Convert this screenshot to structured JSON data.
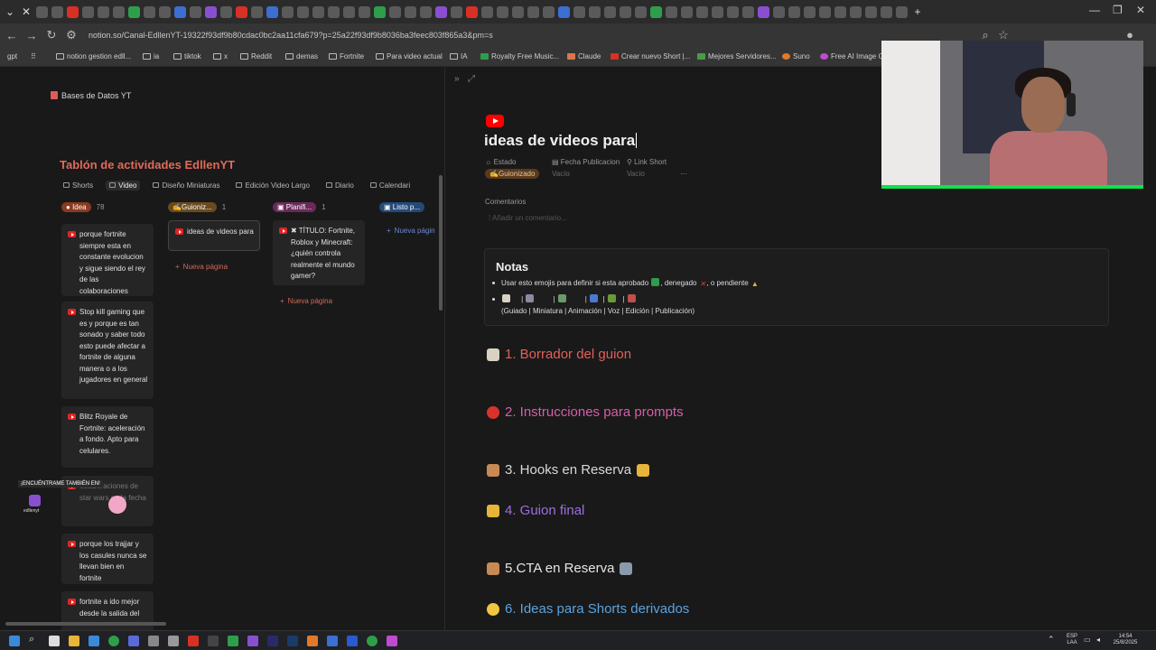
{
  "browser": {
    "url": "notion.so/Canal-EdllenYT-19322f93df9b80cdac0bc2aa11cfa679?p=25a22f93df9b8036ba3feec803f865a3&pm=s",
    "bookmarks": [
      "gpt",
      "notion gestion edll...",
      "ia",
      "tiktok",
      "x",
      "Reddit",
      "demas",
      "Fortnite",
      "Para video actual",
      "IA",
      "Royalty Free Music...",
      "Claude",
      "Crear nuevo Short |...",
      "Mejores Servidores...",
      "Suno",
      "Free AI Image Ge..."
    ]
  },
  "sidebar": {
    "db_title": "Bases de Datos YT",
    "board_title": "Tablón de actividades EdllenYT",
    "views": [
      "Shorts",
      "Video",
      "Diseño Miniaturas",
      "Edición Video Largo",
      "Diario",
      "Calendari"
    ],
    "columns": [
      {
        "label": "Idea",
        "count": "78",
        "color": "#8a3a1e",
        "new_page": ""
      },
      {
        "label": "Guioniz...",
        "count": "1",
        "color": "#6a4a20",
        "new_page": "Nueva página"
      },
      {
        "label": "Planifi...",
        "count": "1",
        "color": "#6a2a5a",
        "new_page": "Nueva página"
      },
      {
        "label": "Listo p...",
        "count": "",
        "color": "#254a7a",
        "new_page": "Nueva págin"
      }
    ],
    "cards": {
      "idea_1": "porque fortnite siempre esta en constante evolucion y sigue siendo el rey de las colaboraciones",
      "idea_2": "Stop kill gaming que es y porque es tan sonado y saber todo esto puede afectar a fortnite de alguna manera o a los jugadores en general",
      "idea_3": "Blitz Royale de Fortnite: aceleración a fondo. Apto para celulares.",
      "idea_4": "colaboraciones de star wars en la fecha",
      "idea_5": "porque los trajjar y los casules nunca se llevan bien en fortnite",
      "idea_6": "fortnite a ido mejor desde la salida del",
      "guion_1": "ideas de videos para",
      "plan_1": "✖ TÍTULO: Fortnite, Roblox y Minecraft: ¿quién controla realmente el mundo gamer?"
    },
    "overlay": {
      "label": "¡ENCUÉNTRAME TAMBIÉN EN!",
      "name": "edllenyt"
    }
  },
  "page": {
    "title": "ideas de videos para",
    "props": {
      "estado_label": "Estado",
      "fecha_label": "Fecha Publicacion",
      "link_label": "Link Short",
      "estado_value": "Guionizado",
      "fecha_value": "Vacío",
      "link_value": "Vacío",
      "more": "···"
    },
    "comments_label": "Comentarios",
    "comments_placeholder": "Añadir un comentario...",
    "notes": {
      "title": "Notas",
      "line1_a": "Usar esto emojis para definir si esta aprobado",
      "line1_b": ", denegado",
      "line1_c": ", o pendiente",
      "line2_a": "(Guiado | Miniatura | Animación | Voz | Edición | Publicación)"
    },
    "sections": [
      {
        "label": "1. Borrador del guion",
        "color": "#e0605a",
        "icon_color": "#d9d2c2"
      },
      {
        "label": "2. Instrucciones para prompts",
        "color": "#d55fa8",
        "icon_color": "#d9322b"
      },
      {
        "label": "3. Hooks en Reserva",
        "color": "#d9d9d9",
        "icon_color": "#c78a55"
      },
      {
        "label": "4. Guion final",
        "color": "#9a6fe0",
        "icon_color": "#e8b43a"
      },
      {
        "label": "5.CTA en Reserva",
        "color": "#e6e6e6",
        "icon_color": "#c78a55"
      },
      {
        "label": "6. Ideas para Shorts derivados",
        "color": "#5aa3e0",
        "icon_color": "#f0c540"
      }
    ]
  },
  "taskbar": {
    "lang": "ESP\nLAA",
    "time": "14:54",
    "date": "25/8/2025"
  }
}
